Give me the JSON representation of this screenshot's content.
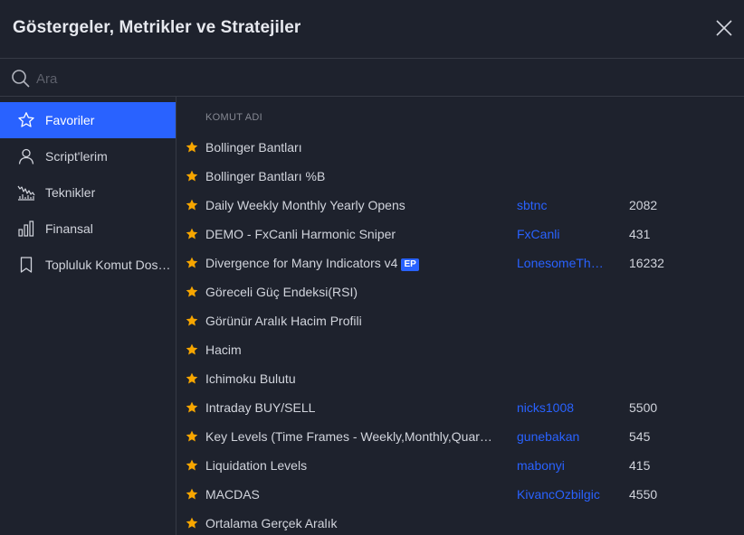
{
  "dialog": {
    "title": "Göstergeler, Metrikler ve Stratejiler"
  },
  "search": {
    "placeholder": "Ara",
    "value": ""
  },
  "sidebar": {
    "items": [
      {
        "label": "Favoriler",
        "icon": "star-icon",
        "active": true
      },
      {
        "label": "Script'lerim",
        "icon": "user-icon",
        "active": false
      },
      {
        "label": "Teknikler",
        "icon": "technicals-chart-icon",
        "active": false
      },
      {
        "label": "Finansal",
        "icon": "financial-bar-chart-icon",
        "active": false
      },
      {
        "label": "Topluluk Komut Dosyaları",
        "icon": "bookmark-icon",
        "active": false
      }
    ]
  },
  "list": {
    "column_header": "KOMUT ADI",
    "rows": [
      {
        "name": "Bollinger Bantları",
        "badge": "",
        "author": "",
        "likes": ""
      },
      {
        "name": "Bollinger Bantları %B",
        "badge": "",
        "author": "",
        "likes": ""
      },
      {
        "name": "Daily Weekly Monthly Yearly Opens",
        "badge": "",
        "author": "sbtnc",
        "likes": "2082"
      },
      {
        "name": "DEMO - FxCanli Harmonic Sniper",
        "badge": "",
        "author": "FxCanli",
        "likes": "431"
      },
      {
        "name": "Divergence for Many Indicators v4",
        "badge": "EP",
        "author": "LonesomeTheBlue",
        "likes": "16232"
      },
      {
        "name": "Göreceli Güç Endeksi(RSI)",
        "badge": "",
        "author": "",
        "likes": ""
      },
      {
        "name": "Görünür Aralık Hacim Profili",
        "badge": "",
        "author": "",
        "likes": ""
      },
      {
        "name": "Hacim",
        "badge": "",
        "author": "",
        "likes": ""
      },
      {
        "name": "Ichimoku Bulutu",
        "badge": "",
        "author": "",
        "likes": ""
      },
      {
        "name": "Intraday BUY/SELL",
        "badge": "",
        "author": "nicks1008",
        "likes": "5500"
      },
      {
        "name": "Key Levels (Time Frames - Weekly,Monthly,Quarterly,Yearly)",
        "badge": "",
        "author": "gunebakan",
        "likes": "545"
      },
      {
        "name": "Liquidation Levels",
        "badge": "",
        "author": "mabonyi",
        "likes": "415"
      },
      {
        "name": "MACDAS",
        "badge": "",
        "author": "KivancOzbilgic",
        "likes": "4550"
      },
      {
        "name": "Ortalama Gerçek Aralık",
        "badge": "",
        "author": "",
        "likes": ""
      }
    ]
  },
  "colors": {
    "background": "#1e222d",
    "accent": "#2962ff",
    "star": "#f7a600",
    "border": "#363a45"
  }
}
